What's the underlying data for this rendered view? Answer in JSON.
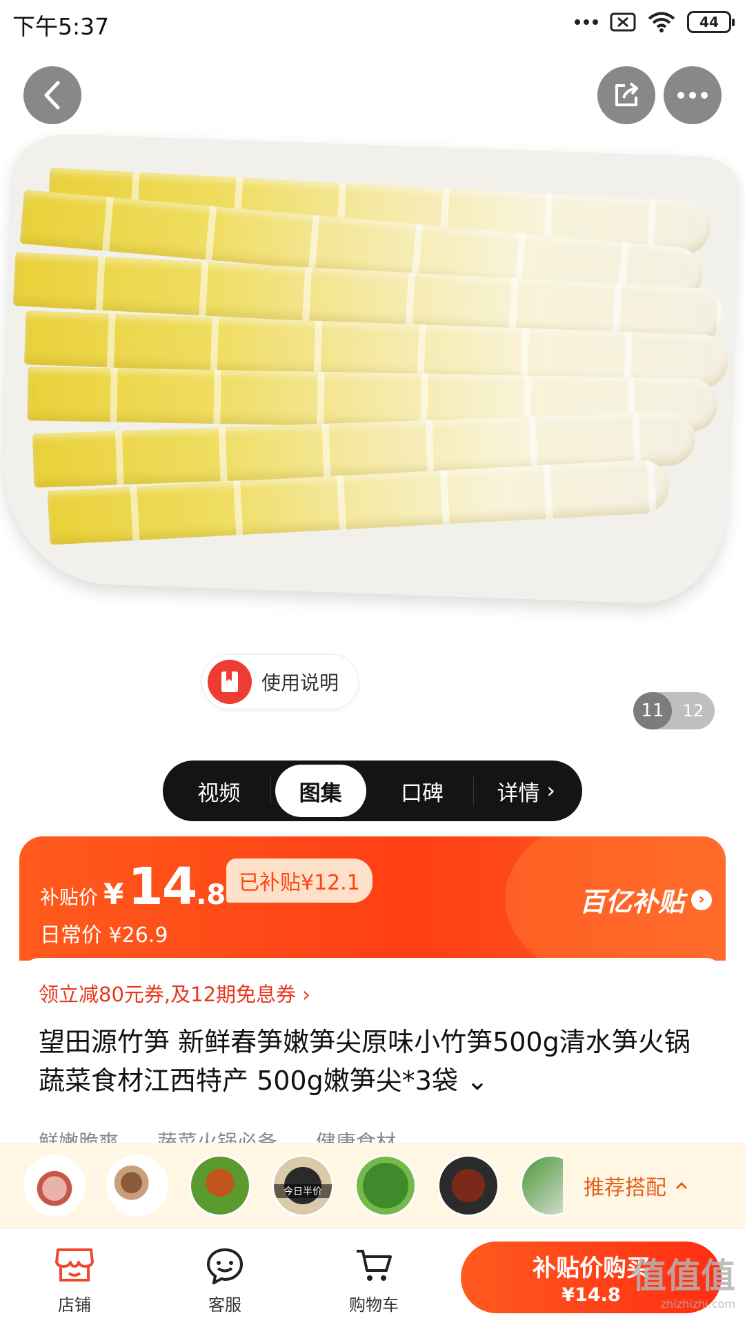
{
  "status_bar": {
    "time": "下午5:37",
    "battery": "44",
    "icons": [
      "dots-icon",
      "sim-off-icon",
      "wifi-icon",
      "battery-icon"
    ]
  },
  "gallery": {
    "image_subject": "bamboo shoots on white plate",
    "manual_label": "使用说明",
    "current_index": "11",
    "total": "12"
  },
  "media_tabs": [
    {
      "label": "视频",
      "active": false
    },
    {
      "label": "图集",
      "active": true
    },
    {
      "label": "口碑",
      "active": false
    },
    {
      "label": "详情",
      "active": false
    }
  ],
  "price": {
    "subsidy_label": "补贴价",
    "currency": "¥",
    "integer": "14",
    "decimal": ".8",
    "subsidy_tag": "已补贴¥12.1",
    "daily_label": "日常价",
    "daily_price": "¥26.9",
    "brand": "百亿补贴",
    "accent": "#ff4214"
  },
  "product": {
    "coupon": "领立减80元券,及12期免息券 ›",
    "title": "望田源竹笋 新鲜春笋嫩笋尖原味小竹笋500g清水笋火锅蔬菜食材江西特产 500g嫩笋尖*3袋 ⌄",
    "tags": [
      "鲜嫩脆爽",
      "蔬菜火锅必备",
      "健康食材"
    ]
  },
  "recommend": {
    "label": "推荐搭配",
    "thumbs": [
      {
        "name": "pork-belly-thumb",
        "caption": ""
      },
      {
        "name": "mushroom-thumb",
        "caption": ""
      },
      {
        "name": "roast-duck-thumb",
        "caption": ""
      },
      {
        "name": "snack-thumb",
        "caption": "今日半价"
      },
      {
        "name": "greens-thumb",
        "caption": ""
      },
      {
        "name": "cured-meat-thumb",
        "caption": ""
      },
      {
        "name": "veg-box-thumb",
        "caption": ""
      }
    ]
  },
  "bottom_bar": {
    "store": "店铺",
    "service": "客服",
    "cart": "购物车",
    "buy_main": "补贴价购买",
    "buy_price": "¥14.8"
  },
  "watermark": {
    "text": "值值值",
    "url": "zhizhizhi.com"
  }
}
